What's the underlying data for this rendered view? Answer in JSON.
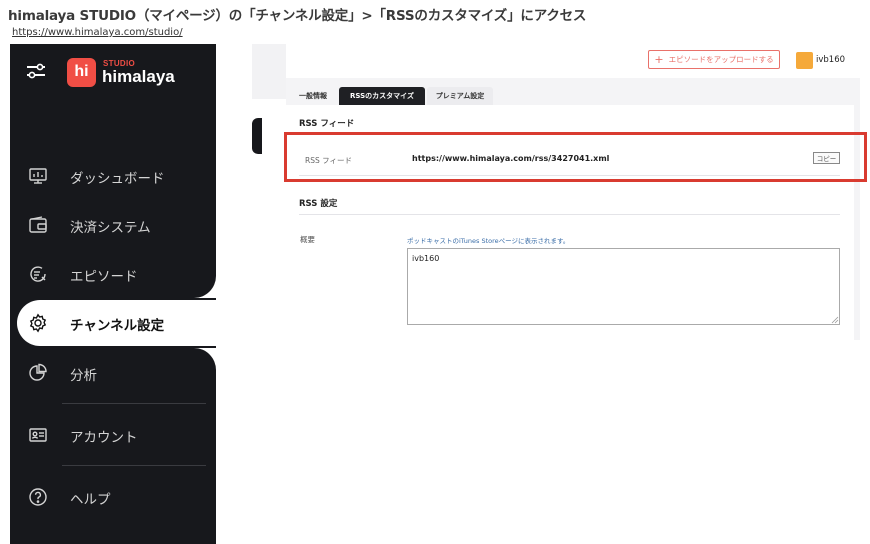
{
  "caption": "himalaya STUDIO（マイページ）の「チャンネル設定」>「RSSのカスタマイズ」にアクセス",
  "url": "https://www.himalaya.com/studio/",
  "logo": {
    "mark": "hi",
    "studio": "STUDIO",
    "name": "himalaya"
  },
  "nav": [
    {
      "label": "ダッシュボード",
      "icon": "dashboard-icon"
    },
    {
      "label": "決済システム",
      "icon": "wallet-icon"
    },
    {
      "label": "エピソード",
      "icon": "episode-icon"
    },
    {
      "label": "チャンネル設定",
      "icon": "gear-icon",
      "active": true
    },
    {
      "label": "分析",
      "icon": "pie-chart-icon"
    },
    {
      "label": "アカウント",
      "icon": "account-card-icon"
    },
    {
      "label": "ヘルプ",
      "icon": "help-icon"
    }
  ],
  "header": {
    "upload_label": "エピソードをアップロードする",
    "username": "ivb160",
    "avatar_color": "#f5a93a"
  },
  "tabs": [
    "一般情報",
    "RSSのカスタマイズ",
    "プレミアム設定"
  ],
  "rss_feed": {
    "section_title": "RSS フィード",
    "row_label": "RSS フィード",
    "url": "https://www.himalaya.com/rss/3427041.xml",
    "copy_label": "コピー"
  },
  "rss_settings": {
    "section_title": "RSS 設定",
    "summary_label": "概要",
    "hint": "ポッドキャストのiTunes Storeページに表示されます。",
    "summary_value": "ivb160"
  },
  "colors": {
    "sidebar": "#17181c",
    "brand": "#f04e45",
    "highlight": "#d93b30"
  }
}
